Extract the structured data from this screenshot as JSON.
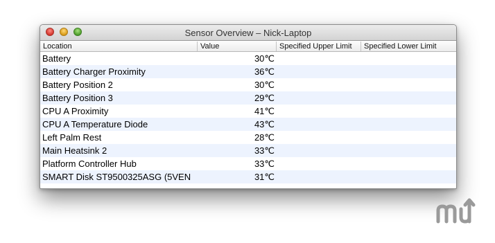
{
  "window": {
    "title": "Sensor Overview – Nick-Laptop"
  },
  "table": {
    "columns": [
      "Location",
      "Value",
      "Specified Upper Limit",
      "Specified Lower Limit"
    ],
    "rows": [
      {
        "location": "Battery",
        "value": "30℃"
      },
      {
        "location": "Battery Charger Proximity",
        "value": "36℃"
      },
      {
        "location": "Battery Position 2",
        "value": "30℃"
      },
      {
        "location": "Battery Position 3",
        "value": "29℃"
      },
      {
        "location": "CPU A Proximity",
        "value": "41℃"
      },
      {
        "location": "CPU A Temperature Diode",
        "value": "43℃"
      },
      {
        "location": "Left Palm Rest",
        "value": "28℃"
      },
      {
        "location": "Main Heatsink 2",
        "value": "33℃"
      },
      {
        "location": "Platform Controller Hub",
        "value": "33℃"
      },
      {
        "location": "SMART Disk ST9500325ASG (5VEN",
        "value": "31℃"
      }
    ]
  },
  "watermark": {
    "icon": "macupdate-logo-icon",
    "color": "#9a9a9a"
  }
}
